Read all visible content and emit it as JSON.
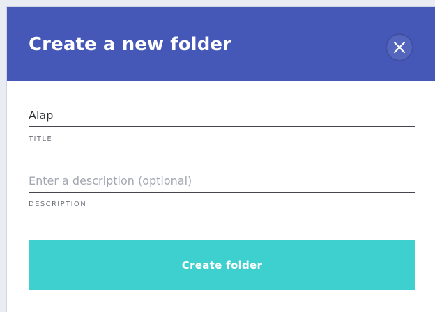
{
  "dialog": {
    "title": "Create a new folder",
    "close_icon": "close-icon"
  },
  "form": {
    "title_field": {
      "value": "Alap",
      "label": "TITLE"
    },
    "description_field": {
      "value": "",
      "placeholder": "Enter a description (optional)",
      "label": "DESCRIPTION"
    },
    "submit_label": "Create folder"
  },
  "colors": {
    "header": "#4558b8",
    "accent_button": "#3ecfcf",
    "background": "#ffffff"
  }
}
